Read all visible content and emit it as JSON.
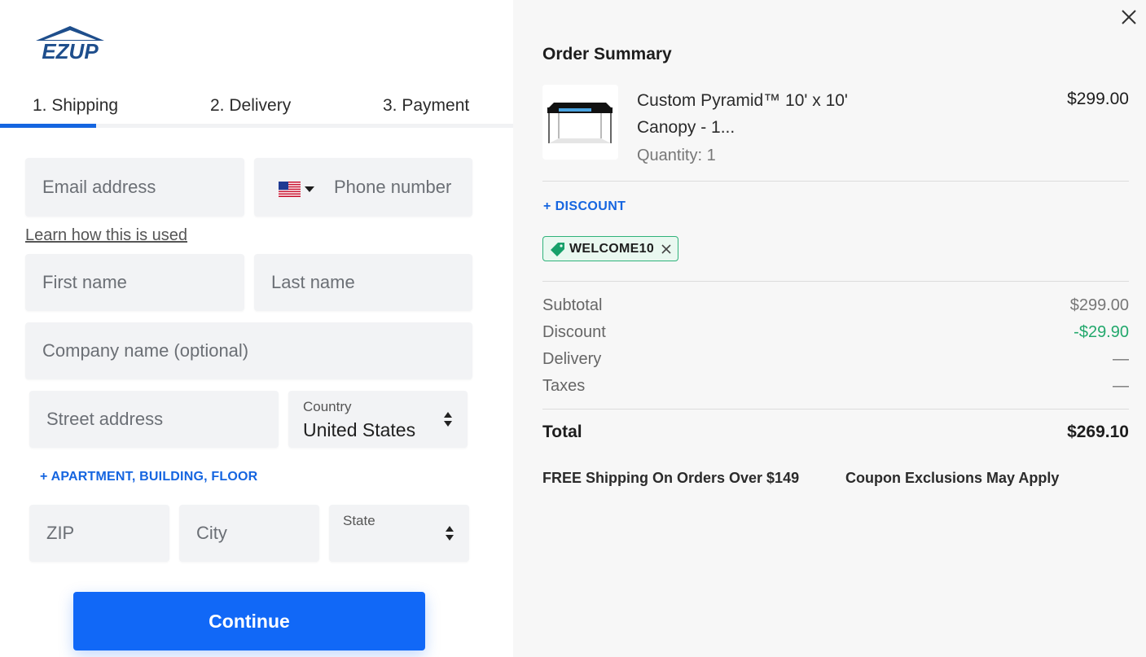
{
  "brand": {
    "logo_text": "EZUP",
    "accent": "#1168f7",
    "logo_color": "#1e4e8c"
  },
  "steps": [
    {
      "label": "1. Shipping",
      "active": true
    },
    {
      "label": "2. Delivery",
      "active": false
    },
    {
      "label": "3. Payment",
      "active": false
    }
  ],
  "form": {
    "email_placeholder": "Email address",
    "phone_placeholder": "Phone number",
    "phone_country_flag": "us-flag-icon",
    "learn_link": "Learn how this is used",
    "first_name_placeholder": "First name",
    "last_name_placeholder": "Last name",
    "company_placeholder": "Company name (optional)",
    "street_placeholder": "Street address",
    "country_label": "Country",
    "country_value": "United States",
    "apartment_link": "+ APARTMENT, BUILDING, FLOOR",
    "zip_placeholder": "ZIP",
    "city_placeholder": "City",
    "state_label": "State",
    "continue_label": "Continue"
  },
  "summary": {
    "title": "Order Summary",
    "product": {
      "name": "Custom Pyramid™ 10' x 10' Canopy - 1...",
      "quantity": "Quantity: 1",
      "price": "$299.00"
    },
    "discount_link": "+ DISCOUNT",
    "coupon_code": "WELCOME10",
    "rows": {
      "subtotal_label": "Subtotal",
      "subtotal_value": "$299.00",
      "discount_label": "Discount",
      "discount_value": "-$29.90",
      "delivery_label": "Delivery",
      "delivery_value": "—",
      "taxes_label": "Taxes",
      "taxes_value": "—"
    },
    "total_label": "Total",
    "total_value": "$269.10",
    "note_shipping": "FREE Shipping On Orders Over $149",
    "note_coupon": "Coupon Exclusions May Apply"
  }
}
